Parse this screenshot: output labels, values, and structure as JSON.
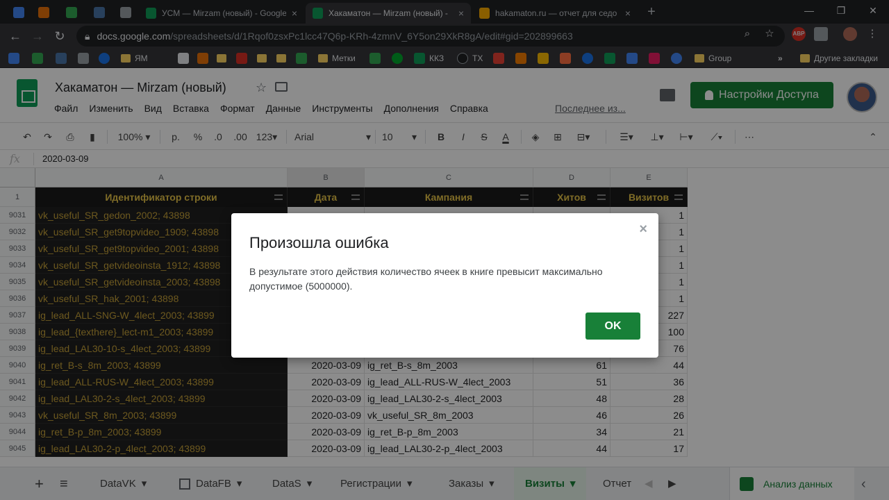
{
  "browser": {
    "tabs": [
      {
        "label": "УСМ — Mirzam (новый) - Google"
      },
      {
        "label": "Хакаматон — Mirzam (новый) -"
      },
      {
        "label": "hakamaton.ru — отчет для седо"
      }
    ],
    "url_host": "docs.google.com",
    "url_path": "/spreadsheets/d/1Rqof0zsxPc1lcc47Q6p-KRh-4zmnV_6Y5on29XkR8gA/edit#gid=202899663",
    "bookmarks": [
      "ЯМ",
      "Метки",
      "ККЗ",
      "TX",
      "Group"
    ],
    "other_bookmarks": "Другие закладки",
    "more_chevron": "»"
  },
  "sheets": {
    "title": "Хакаматон — Mirzam (новый)",
    "menu": [
      "Файл",
      "Изменить",
      "Вид",
      "Вставка",
      "Формат",
      "Данные",
      "Инструменты",
      "Дополнения",
      "Справка"
    ],
    "last_edit": "Последнее из...",
    "share_label": "Настройки Доступа",
    "toolbar": {
      "zoom": "100%",
      "currency": "р.",
      "percent": "%",
      "dec_less": ".0",
      "dec_more": ".00",
      "format_more": "123",
      "font": "Arial",
      "font_size": "10",
      "bold": "B",
      "italic": "I",
      "strike": "S",
      "text_color": "A",
      "more": "⋯"
    },
    "formula_bar_value": "2020-03-09"
  },
  "grid": {
    "columns": [
      "A",
      "B",
      "C",
      "D",
      "E"
    ],
    "header_row_number": "1",
    "headers": [
      "Идентификатор строки",
      "Дата",
      "Кампания",
      "Хитов",
      "Визитов"
    ],
    "rows": [
      {
        "n": "9031",
        "a": "vk_useful_SR_gedon_2002; 43898",
        "b": "",
        "c": "",
        "d": "",
        "e": "1"
      },
      {
        "n": "9032",
        "a": "vk_useful_SR_get9topvideo_1909; 43898",
        "b": "",
        "c": "",
        "d": "",
        "e": "1"
      },
      {
        "n": "9033",
        "a": "vk_useful_SR_get9topvideo_2001; 43898",
        "b": "",
        "c": "",
        "d": "",
        "e": "1"
      },
      {
        "n": "9034",
        "a": "vk_useful_SR_getvideoinsta_1912; 43898",
        "b": "",
        "c": "",
        "d": "",
        "e": "1"
      },
      {
        "n": "9035",
        "a": "vk_useful_SR_getvideoinsta_2003; 43898",
        "b": "",
        "c": "",
        "d": "",
        "e": "1"
      },
      {
        "n": "9036",
        "a": "vk_useful_SR_hak_2001; 43898",
        "b": "",
        "c": "",
        "d": "",
        "e": "1"
      },
      {
        "n": "9037",
        "a": "ig_lead_ALL-SNG-W_4lect_2003; 43899",
        "b": "",
        "c": "",
        "d": "",
        "e": "227"
      },
      {
        "n": "9038",
        "a": "ig_lead_{texthere}_lect-m1_2003; 43899",
        "b": "",
        "c": "",
        "d": "",
        "e": "100"
      },
      {
        "n": "9039",
        "a": "ig_lead_LAL30-10-s_4lect_2003; 43899",
        "b": "",
        "c": "",
        "d": "",
        "e": "76"
      },
      {
        "n": "9040",
        "a": "ig_ret_B-s_8m_2003; 43899",
        "b": "2020-03-09",
        "c": "ig_ret_B-s_8m_2003",
        "d": "61",
        "e": "44"
      },
      {
        "n": "9041",
        "a": "ig_lead_ALL-RUS-W_4lect_2003; 43899",
        "b": "2020-03-09",
        "c": "ig_lead_ALL-RUS-W_4lect_2003",
        "d": "51",
        "e": "36"
      },
      {
        "n": "9042",
        "a": "ig_lead_LAL30-2-s_4lect_2003; 43899",
        "b": "2020-03-09",
        "c": "ig_lead_LAL30-2-s_4lect_2003",
        "d": "48",
        "e": "28"
      },
      {
        "n": "9043",
        "a": "vk_useful_SR_8m_2003; 43899",
        "b": "2020-03-09",
        "c": "vk_useful_SR_8m_2003",
        "d": "46",
        "e": "26"
      },
      {
        "n": "9044",
        "a": "ig_ret_B-p_8m_2003; 43899",
        "b": "2020-03-09",
        "c": "ig_ret_B-p_8m_2003",
        "d": "34",
        "e": "21"
      },
      {
        "n": "9045",
        "a": "ig_lead_LAL30-2-p_4lect_2003; 43899",
        "b": "2020-03-09",
        "c": "ig_lead_LAL30-2-p_4lect_2003",
        "d": "44",
        "e": "17"
      }
    ]
  },
  "sheet_tabs": {
    "add": "+",
    "list": "≡",
    "tabs": [
      "DataVK",
      "DataFB",
      "DataS",
      "Регистрации",
      "Заказы",
      "Визиты",
      "Отчет"
    ],
    "active": "Визиты",
    "explore": "Анализ данных"
  },
  "dialog": {
    "title": "Произошла ошибка",
    "message": "В результате этого действия количество ячеек в книге превысит максимально допустимое (5000000).",
    "ok": "OK",
    "close": "×"
  },
  "colors": {
    "accent_green": "#188038",
    "header_text": "#e8c547",
    "dark_cell_text": "#c7a23a"
  }
}
